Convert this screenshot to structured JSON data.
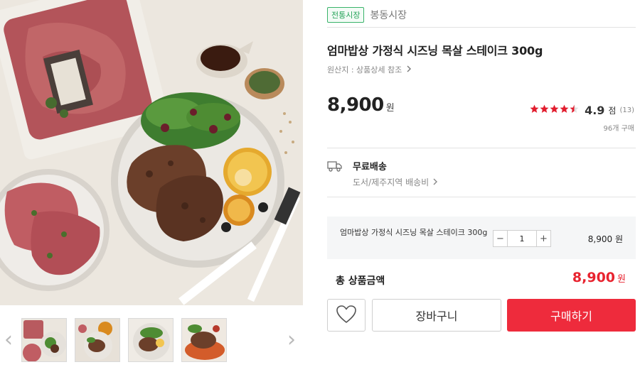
{
  "store": {
    "badge": "전통시장",
    "name": "봉동시장"
  },
  "product": {
    "title": "엄마밥상 가정식 시즈닝 목살 스테이크 300g",
    "origin": "원산지 : 상품상세 참조",
    "origin_icon": "chevron-right-icon",
    "price": "8,900",
    "currency": "원"
  },
  "rating": {
    "stars": 4.5,
    "max_stars": 5,
    "score": "4.9",
    "unit": "점",
    "count": "(13)",
    "purchases": "96개 구매"
  },
  "shipping": {
    "icon": "truck-icon",
    "title": "무료배송",
    "sub": "도서/제주지역 배송비",
    "sub_icon": "chevron-right-icon"
  },
  "option": {
    "name": "엄마밥상 가정식 시즈닝 목살 스테이크 300g",
    "minus": "−",
    "quantity": "1",
    "plus": "+",
    "price": "8,900 원"
  },
  "total": {
    "label": "총 상품금액",
    "amount": "8,900",
    "currency": "원"
  },
  "actions": {
    "wish_icon": "heart-outline-icon",
    "cart": "장바구니",
    "buy": "구매하기"
  },
  "gallery": {
    "prev": "‹",
    "next": "›",
    "thumbnail_count": 4,
    "prev_icon": "chevron-left-icon",
    "next_icon": "chevron-right-icon"
  },
  "colors": {
    "accent": "#ee2b3c",
    "price_red": "#e8232f",
    "badge_green": "#27a45a",
    "star": "#e11d2e"
  }
}
